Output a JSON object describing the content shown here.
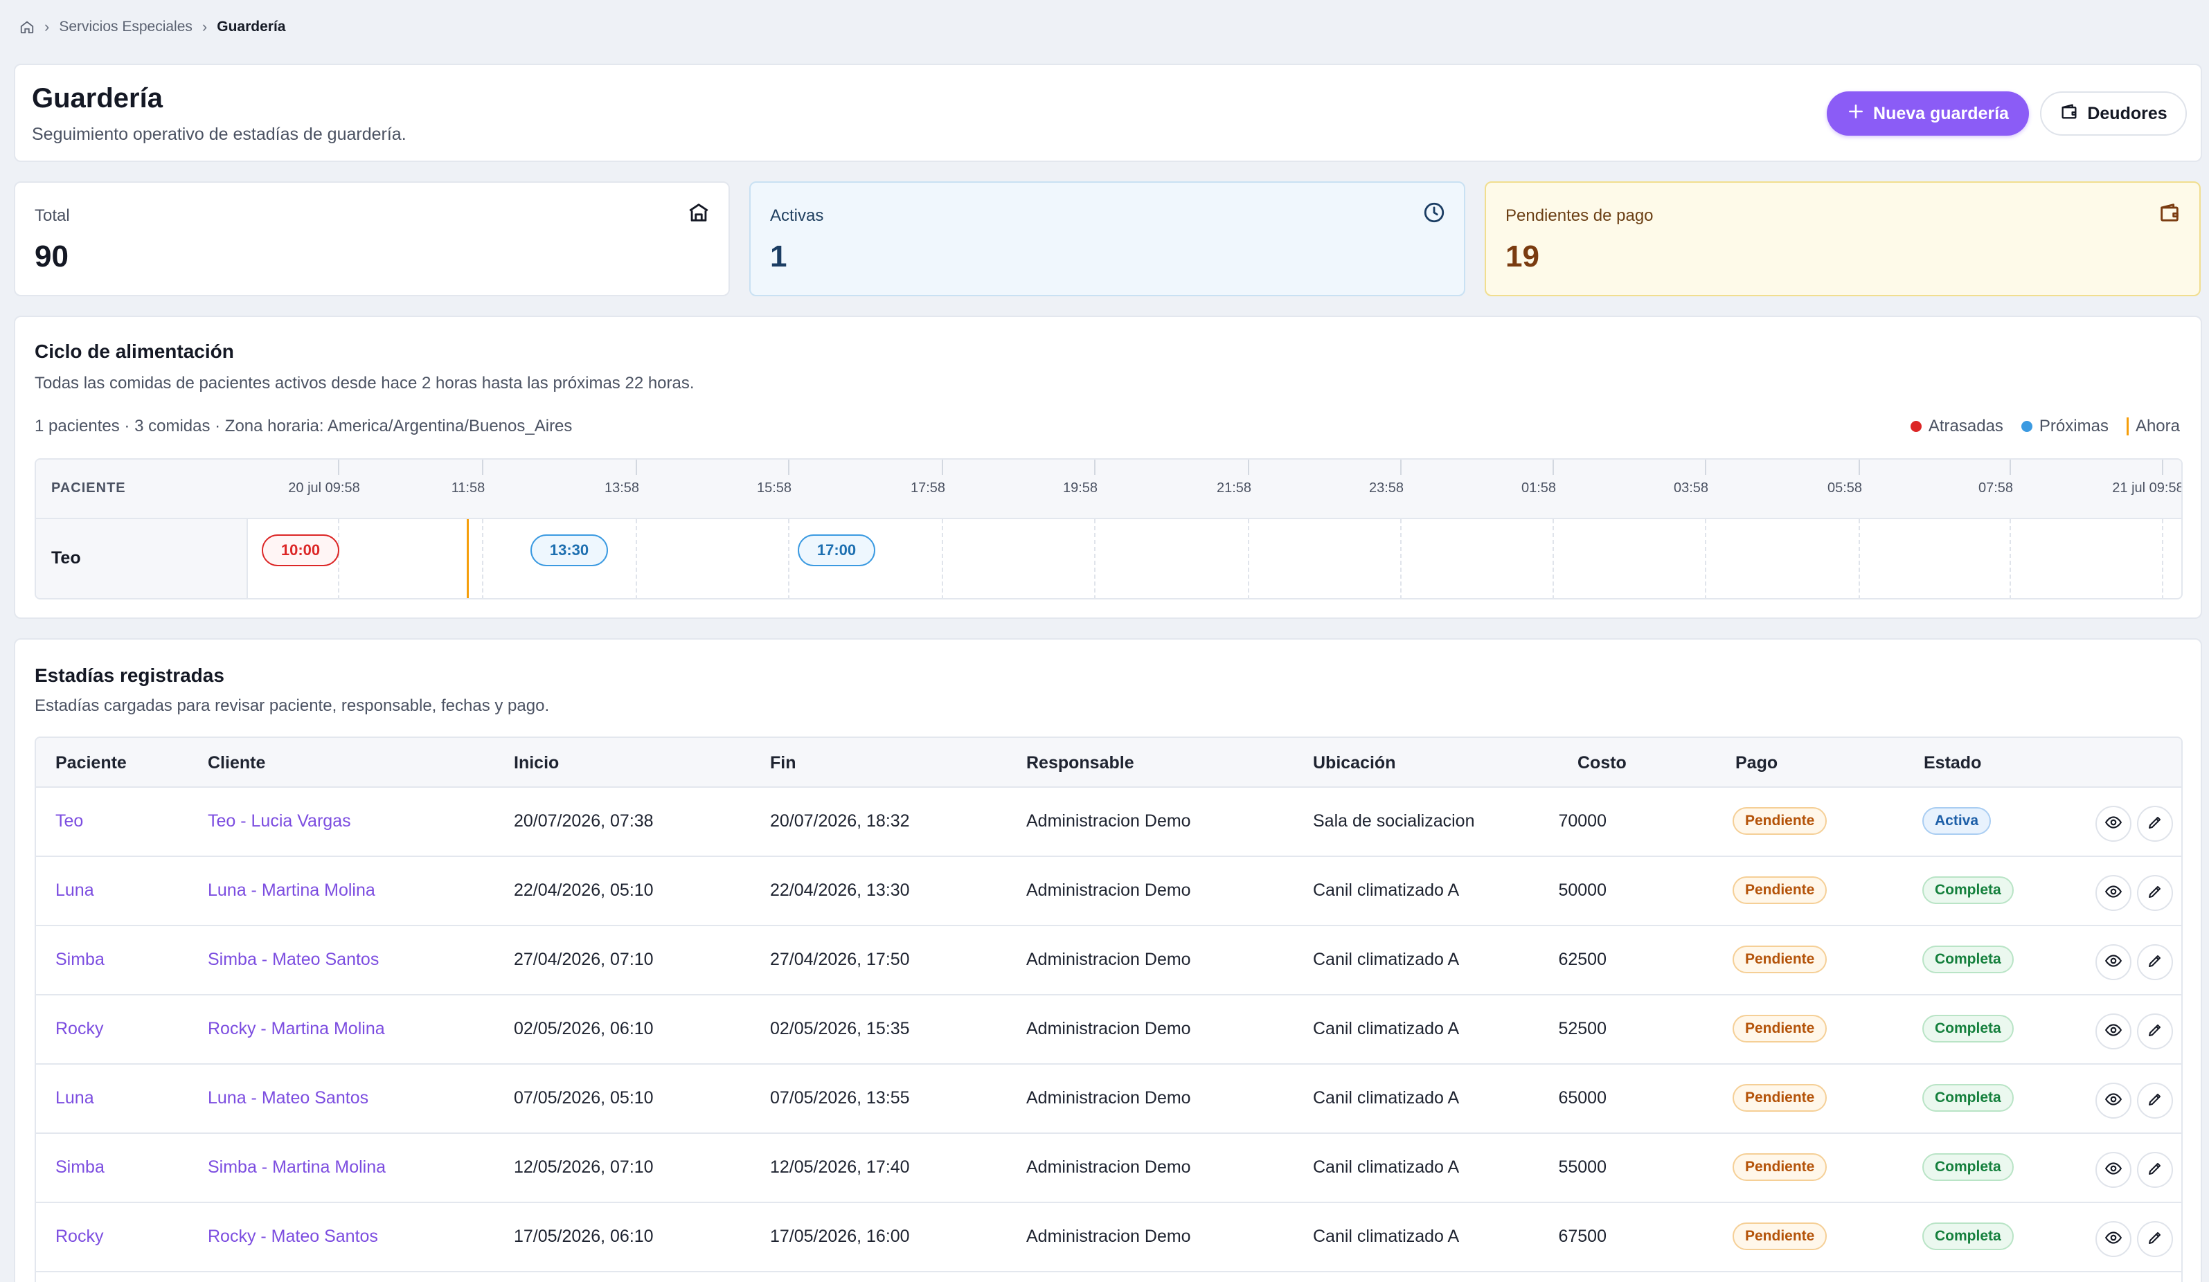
{
  "breadcrumb": {
    "items": [
      "Servicios Especiales"
    ],
    "current": "Guardería"
  },
  "header": {
    "title": "Guardería",
    "subtitle": "Seguimiento operativo de estadías de guardería.",
    "new_button": "Nueva guardería",
    "debtors_button": "Deudores"
  },
  "stats": {
    "total": {
      "label": "Total",
      "value": "90"
    },
    "active": {
      "label": "Activas",
      "value": "1"
    },
    "pending": {
      "label": "Pendientes de pago",
      "value": "19"
    }
  },
  "feeding": {
    "title": "Ciclo de alimentación",
    "subtitle": "Todas las comidas de pacientes activos desde hace 2 horas hasta las próximas 22 horas.",
    "summary": "1 pacientes · 3 comidas · Zona horaria: America/Argentina/Buenos_Aires",
    "legend": {
      "late": "Atrasadas",
      "upcoming": "Próximas",
      "now": "Ahora"
    },
    "column_label": "PACIENTE",
    "ticks": [
      "20 jul 09:58",
      "11:58",
      "13:58",
      "15:58",
      "17:58",
      "19:58",
      "21:58",
      "23:58",
      "01:58",
      "03:58",
      "05:58",
      "07:58",
      "21 jul 09:58"
    ],
    "patient": "Teo",
    "meals": [
      {
        "time": "10:00",
        "status": "late"
      },
      {
        "time": "13:30",
        "status": "upcoming"
      },
      {
        "time": "17:00",
        "status": "upcoming"
      }
    ],
    "colors": {
      "late": "#dc2626",
      "upcoming": "#3b9ae1",
      "now": "#f59e0b"
    }
  },
  "stays": {
    "title": "Estadías registradas",
    "subtitle": "Estadías cargadas para revisar paciente, responsable, fechas y pago.",
    "columns": [
      "Paciente",
      "Cliente",
      "Inicio",
      "Fin",
      "Responsable",
      "Ubicación",
      "Costo",
      "Pago",
      "Estado"
    ],
    "rows": [
      {
        "patient": "Teo",
        "client": "Teo - Lucia Vargas",
        "start": "20/07/2026, 07:38",
        "end": "20/07/2026, 18:32",
        "owner": "Administracion Demo",
        "location": "Sala de socializacion",
        "cost": "70000",
        "payment": "Pendiente",
        "status": "Activa"
      },
      {
        "patient": "Luna",
        "client": "Luna - Martina Molina",
        "start": "22/04/2026, 05:10",
        "end": "22/04/2026, 13:30",
        "owner": "Administracion Demo",
        "location": "Canil climatizado A",
        "cost": "50000",
        "payment": "Pendiente",
        "status": "Completa"
      },
      {
        "patient": "Simba",
        "client": "Simba - Mateo Santos",
        "start": "27/04/2026, 07:10",
        "end": "27/04/2026, 17:50",
        "owner": "Administracion Demo",
        "location": "Canil climatizado A",
        "cost": "62500",
        "payment": "Pendiente",
        "status": "Completa"
      },
      {
        "patient": "Rocky",
        "client": "Rocky - Martina Molina",
        "start": "02/05/2026, 06:10",
        "end": "02/05/2026, 15:35",
        "owner": "Administracion Demo",
        "location": "Canil climatizado A",
        "cost": "52500",
        "payment": "Pendiente",
        "status": "Completa"
      },
      {
        "patient": "Luna",
        "client": "Luna - Mateo Santos",
        "start": "07/05/2026, 05:10",
        "end": "07/05/2026, 13:55",
        "owner": "Administracion Demo",
        "location": "Canil climatizado A",
        "cost": "65000",
        "payment": "Pendiente",
        "status": "Completa"
      },
      {
        "patient": "Simba",
        "client": "Simba - Martina Molina",
        "start": "12/05/2026, 07:10",
        "end": "12/05/2026, 17:40",
        "owner": "Administracion Demo",
        "location": "Canil climatizado A",
        "cost": "55000",
        "payment": "Pendiente",
        "status": "Completa"
      },
      {
        "patient": "Rocky",
        "client": "Rocky - Mateo Santos",
        "start": "17/05/2026, 06:10",
        "end": "17/05/2026, 16:00",
        "owner": "Administracion Demo",
        "location": "Canil climatizado A",
        "cost": "67500",
        "payment": "Pendiente",
        "status": "Completa"
      }
    ]
  },
  "icons": {
    "home": "home-icon",
    "house": "house-icon",
    "clock": "clock-icon",
    "wallet": "wallet-icon",
    "plus": "plus-icon",
    "eye": "eye-icon",
    "pencil": "pencil-icon"
  }
}
